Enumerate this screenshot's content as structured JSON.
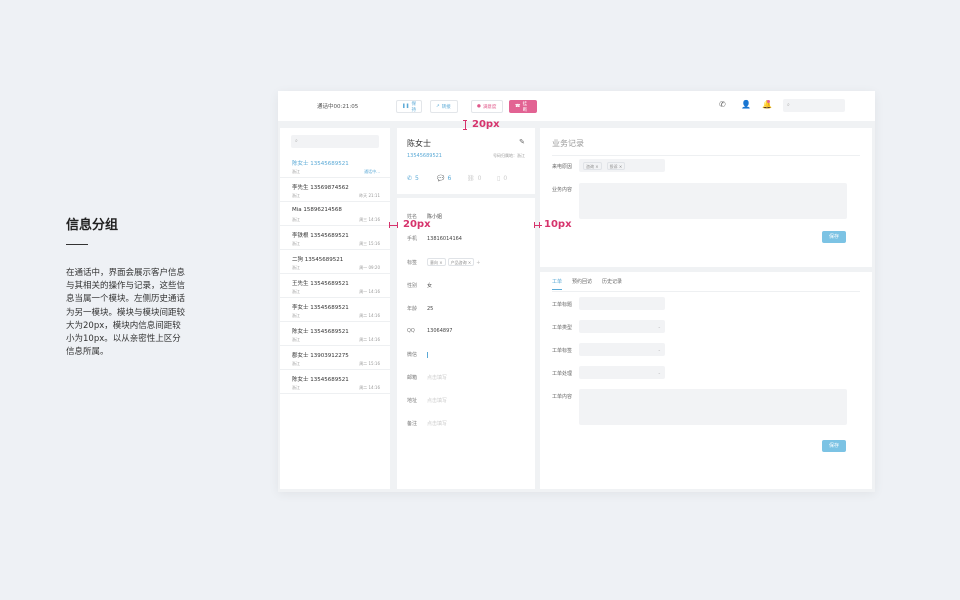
{
  "doc": {
    "title": "信息分组",
    "body": "在通话中，界面会展示客户信息与其相关的操作与记录，这些信息当属一个模块。左侧历史通话为另一模块。模块与模块间距较大为20px，模块内信息间距较小为10px。以从亲密性上区分信息所属。"
  },
  "annotations": {
    "top_gap": "20px",
    "module_gap": "20px",
    "inner_gap": "10px"
  },
  "topbar": {
    "timer": "通话中00:21:05",
    "hold": "保持",
    "transfer": "转接",
    "survey": "满意度",
    "hangup": "挂断"
  },
  "history": {
    "items": [
      {
        "name": "陈女士",
        "phone": "13545689521",
        "loc": "浙江",
        "time": "通话中..."
      },
      {
        "name": "李先生",
        "phone": "13569874562",
        "loc": "浙江",
        "time": "昨天 21:11"
      },
      {
        "name": "Mia",
        "phone": "15896214568",
        "loc": "浙江",
        "time": "周三 14:16"
      },
      {
        "name": "李铁根",
        "phone": "13545689521",
        "loc": "浙江",
        "time": "周三 15:16"
      },
      {
        "name": "二狗",
        "phone": "13545689521",
        "loc": "浙江",
        "time": "周一 09:20"
      },
      {
        "name": "王先生",
        "phone": "13545689521",
        "loc": "浙江",
        "time": "周一 14:16"
      },
      {
        "name": "李女士",
        "phone": "13545689521",
        "loc": "浙江",
        "time": "周二 14:16"
      },
      {
        "name": "陈女士",
        "phone": "13545689521",
        "loc": "浙江",
        "time": "周二 14:16"
      },
      {
        "name": "郡女士",
        "phone": "13903912275",
        "loc": "浙江",
        "time": "周二 15:16"
      },
      {
        "name": "陈女士",
        "phone": "13545689521",
        "loc": "浙江",
        "time": "周二 14:16"
      }
    ]
  },
  "customer": {
    "name": "陈女士",
    "phone": "13545689521",
    "region": "号码归属地：浙江",
    "stats": {
      "calls": "5",
      "messages": "6",
      "links": "0",
      "files": "0"
    },
    "fields": [
      {
        "label": "姓名",
        "value": "陈小姐"
      },
      {
        "label": "手机",
        "value": "13816014164"
      },
      {
        "label": "标签",
        "tags": [
          "意向 ×",
          "产品咨询 ×"
        ]
      },
      {
        "label": "性别",
        "value": "女"
      },
      {
        "label": "年龄",
        "value": "25"
      },
      {
        "label": "QQ",
        "value": "13064897"
      },
      {
        "label": "微信",
        "value": ""
      },
      {
        "label": "邮箱",
        "placeholder": "点击填写"
      },
      {
        "label": "地址",
        "placeholder": "点击填写"
      },
      {
        "label": "备注",
        "placeholder": "点击填写"
      }
    ]
  },
  "business": {
    "title": "业务记录",
    "reason_label": "来电原因",
    "reason_tags": [
      "咨询 ×",
      "投诉 ×"
    ],
    "content_label": "业务内容",
    "save": "保存"
  },
  "ticket": {
    "tabs": [
      "工单",
      "预约回访",
      "历史记录"
    ],
    "fields": [
      "工单标题",
      "工单类型",
      "工单标签",
      "工单处理",
      "工单内容"
    ],
    "save": "保存"
  }
}
